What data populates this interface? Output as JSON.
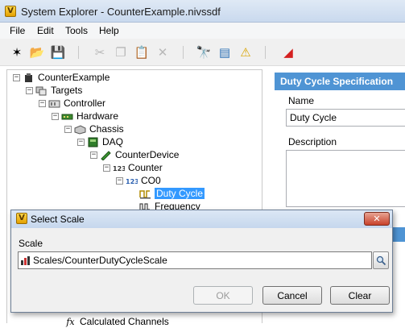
{
  "window": {
    "title": "System Explorer - CounterExample.nivssdf",
    "app_icon": "veristand-icon"
  },
  "menu": [
    "File",
    "Edit",
    "Tools",
    "Help"
  ],
  "toolbar": [
    {
      "name": "wizard-icon",
      "glyph": "✶",
      "enabled": true
    },
    {
      "name": "open-folder-icon",
      "glyph": "📂",
      "enabled": true
    },
    {
      "name": "save-icon",
      "glyph": "💾",
      "enabled": true
    },
    {
      "name": "cut-icon",
      "glyph": "✂",
      "enabled": false
    },
    {
      "name": "copy-icon",
      "glyph": "❐",
      "enabled": false
    },
    {
      "name": "paste-icon",
      "glyph": "📋",
      "enabled": false
    },
    {
      "name": "delete-icon",
      "glyph": "✕",
      "enabled": false
    },
    {
      "name": "find-icon",
      "glyph": "🔭",
      "enabled": true
    },
    {
      "name": "properties-icon",
      "glyph": "▤",
      "enabled": true
    },
    {
      "name": "warning-icon",
      "glyph": "⚠",
      "enabled": true
    },
    {
      "name": "deploy-icon",
      "glyph": "◢",
      "enabled": true
    }
  ],
  "tree": [
    {
      "label": "CounterExample",
      "icon": "project-icon"
    },
    {
      "label": "Targets",
      "icon": "targets-icon"
    },
    {
      "label": "Controller",
      "icon": "controller-icon"
    },
    {
      "label": "Hardware",
      "icon": "hardware-icon"
    },
    {
      "label": "Chassis",
      "icon": "chassis-icon"
    },
    {
      "label": "DAQ",
      "icon": "daq-icon"
    },
    {
      "label": "CounterDevice",
      "icon": "device-icon"
    },
    {
      "label": "Counter",
      "icon": "counter-icon"
    },
    {
      "label": "CO0",
      "icon": "counter-channel-icon"
    },
    {
      "label": "Duty Cycle",
      "icon": "duty-cycle-icon",
      "selected": true
    },
    {
      "label": "Frequency",
      "icon": "frequency-icon"
    },
    {
      "label": "Calculated Channels",
      "icon": "formula-icon"
    }
  ],
  "spec": {
    "header": "Duty Cycle Specification",
    "name_label": "Name",
    "name_value": "Duty Cycle",
    "description_label": "Description",
    "description_value": ""
  },
  "dialog": {
    "title": "Select Scale",
    "close_glyph": "✕",
    "scale_label": "Scale",
    "scale_value": "Scales/CounterDutyCycleScale",
    "ok_label": "OK",
    "cancel_label": "Cancel",
    "clear_label": "Clear"
  },
  "colors": {
    "selection": "#3399ff",
    "spec_header": "#4f94d4",
    "close_button": "#c8412a"
  }
}
